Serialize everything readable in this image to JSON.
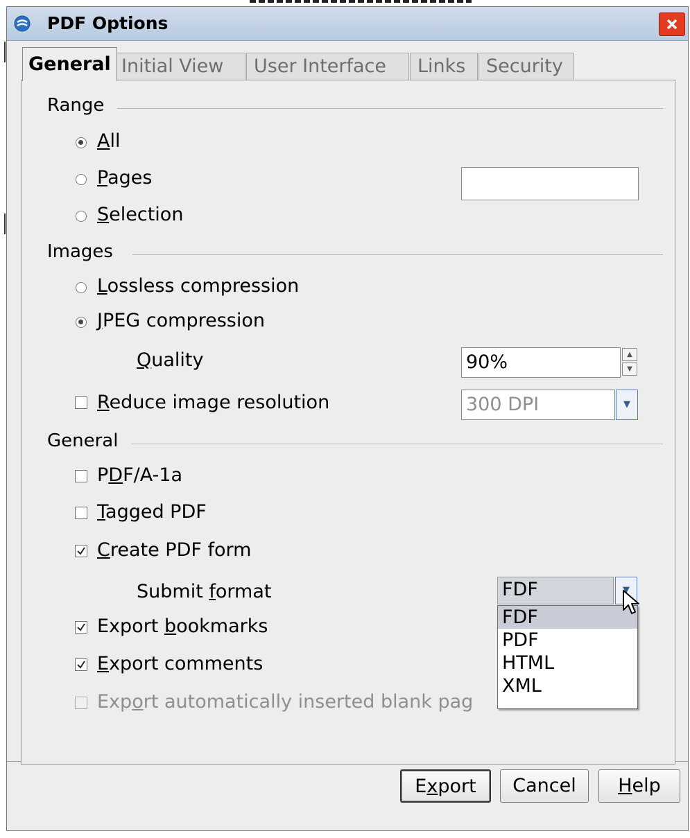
{
  "window": {
    "title": "PDF Options"
  },
  "tabs": [
    {
      "label": "General"
    },
    {
      "label": "Initial View"
    },
    {
      "label": "User Interface"
    },
    {
      "label": "Links"
    },
    {
      "label": "Security"
    }
  ],
  "range": {
    "heading": "Range",
    "all": {
      "mnemonic": "A",
      "rest": "ll",
      "checked": true
    },
    "pages": {
      "mnemonic": "P",
      "rest": "ages",
      "checked": false,
      "value": ""
    },
    "selection": {
      "mnemonic": "S",
      "rest": "election",
      "checked": false
    }
  },
  "images": {
    "heading": "Images",
    "lossless": {
      "mnemonic": "L",
      "rest": "ossless compression",
      "checked": false
    },
    "jpeg": {
      "mnemonic": "J",
      "rest": "PEG compression",
      "checked": true
    },
    "quality": {
      "mnemonic": "Q",
      "rest": "uality",
      "value": "90%"
    },
    "reduce": {
      "mnemonic": "R",
      "rest": "educe image resolution",
      "checked": false,
      "value": "300 DPI"
    }
  },
  "general": {
    "heading": "General",
    "pdfa": {
      "pre": "P",
      "mnemonic": "D",
      "rest": "F/A-1a",
      "checked": false
    },
    "tagged": {
      "mnemonic": "T",
      "rest": "agged PDF",
      "checked": false
    },
    "form": {
      "mnemonic": "C",
      "rest": "reate PDF form",
      "checked": true
    },
    "submit": {
      "pre": "Submit ",
      "mnemonic": "f",
      "rest": "ormat",
      "value": "FDF"
    },
    "bookmarks": {
      "pre": "Export ",
      "mnemonic": "b",
      "rest": "ookmarks",
      "checked": true
    },
    "comments": {
      "mnemonic": "E",
      "rest": "xport comments",
      "checked": true
    },
    "blank": {
      "pre": "Exp",
      "mnemonic": "o",
      "rest": "rt automatically inserted blank pag",
      "checked": false,
      "disabled": true
    }
  },
  "submit_format_options": [
    "FDF",
    "PDF",
    "HTML",
    "XML"
  ],
  "buttons": {
    "export": {
      "pre": "E",
      "mnemonic": "x",
      "rest": "port"
    },
    "cancel": "Cancel",
    "help": {
      "mnemonic": "H",
      "rest": "elp"
    }
  },
  "colors": {
    "titlebar": "#b9cbe1",
    "close": "#e23b1f",
    "dialog_bg": "#ededed",
    "list_selected": "#c9ccd6"
  }
}
